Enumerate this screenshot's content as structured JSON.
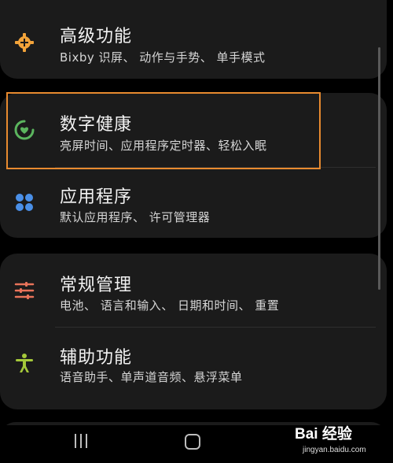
{
  "settings": {
    "items": [
      {
        "title": "高级功能",
        "subtitle": "Bixby 识屏、 动作与手势、 单手模式",
        "icon": "plus-gear-icon",
        "color": "#f2a33a"
      },
      {
        "title": "数字健康",
        "subtitle": "亮屏时间、应用程序定时器、轻松入眠",
        "icon": "digital-wellbeing-icon",
        "color": "#5bb55e"
      },
      {
        "title": "应用程序",
        "subtitle": "默认应用程序、 许可管理器",
        "icon": "apps-grid-icon",
        "color": "#4a8fe7"
      },
      {
        "title": "常规管理",
        "subtitle": "电池、 语言和输入、 日期和时间、 重置",
        "icon": "sliders-icon",
        "color": "#e8735a"
      },
      {
        "title": "辅助功能",
        "subtitle": "语音助手、单声道音频、悬浮菜单",
        "icon": "accessibility-icon",
        "color": "#a5c83a"
      }
    ]
  },
  "highlight_color": "#e88a2f",
  "watermark": {
    "brand": "Bai 经验",
    "url": "jingyan.baidu.com"
  }
}
